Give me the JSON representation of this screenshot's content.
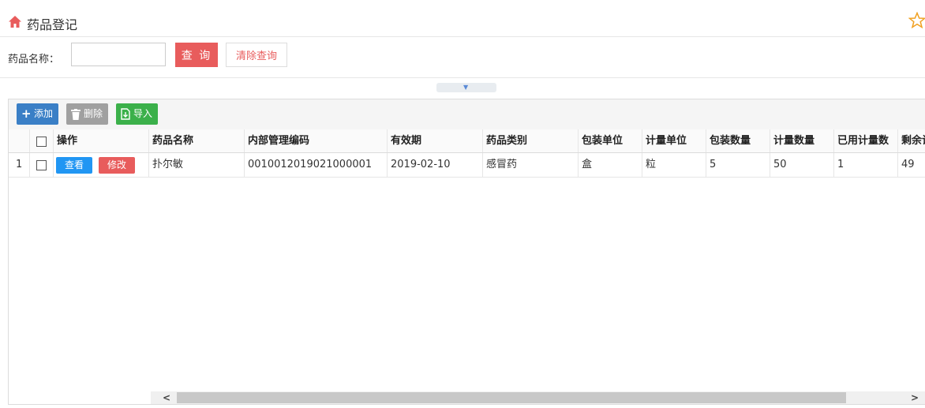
{
  "header": {
    "title": "药品登记",
    "home_icon": "home-icon",
    "star_icon": "star-icon"
  },
  "search": {
    "label": "药品名称：",
    "value": "",
    "query_label": "查 询",
    "clear_label": "清除查询"
  },
  "collapse": {
    "icon": "▼"
  },
  "toolbar": {
    "add_label": "添加",
    "delete_label": "删除",
    "import_label": "导入"
  },
  "table": {
    "columns": [
      "操作",
      "药品名称",
      "内部管理编码",
      "有效期",
      "药品类别",
      "包装单位",
      "计量单位",
      "包装数量",
      "计量数量",
      "已用计量数",
      "剩余计量数"
    ],
    "rows": [
      {
        "index": "1",
        "view_label": "查看",
        "edit_label": "修改",
        "name": "扑尔敏",
        "code": "0010012019021000001",
        "expiry": "2019-02-10",
        "category": "感冒药",
        "pack_unit": "盒",
        "measure_unit": "粒",
        "pack_qty": "5",
        "measure_qty": "50",
        "used_qty": "1",
        "remaining_qty": "49"
      }
    ]
  },
  "colors": {
    "accent_red": "#e85c5c",
    "add_blue": "#3a7fc6",
    "view_blue": "#2196f3",
    "import_green": "#3bb04a",
    "delete_gray": "#a0a0a0"
  }
}
